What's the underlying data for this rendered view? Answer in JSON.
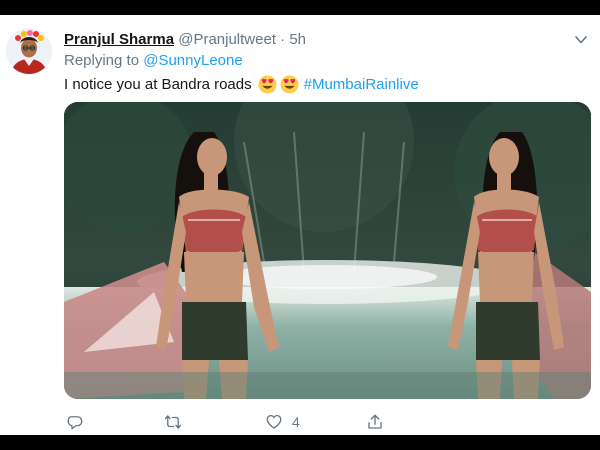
{
  "tweet": {
    "author_name": "Pranjul Sharma",
    "author_handle": "@Pranjultweet",
    "separator": "·",
    "time": "5h",
    "reply_prefix": "Replying to",
    "reply_to": "@SunnyLeone",
    "text": "I notice you at Bandra roads",
    "emojis": [
      "heart-eyes-emoji",
      "heart-eyes-emoji"
    ],
    "hashtag": "#MumbaiRainlive"
  },
  "actions": {
    "reply_count": "",
    "retweet_count": "",
    "like_count": "4",
    "share_count": ""
  },
  "icons": [
    "chevron-down-icon",
    "reply-icon",
    "retweet-icon",
    "like-icon",
    "share-icon"
  ],
  "colors": {
    "link": "#1da1f2",
    "text_primary": "#14171a",
    "text_secondary": "#657786",
    "background": "#ffffff"
  }
}
